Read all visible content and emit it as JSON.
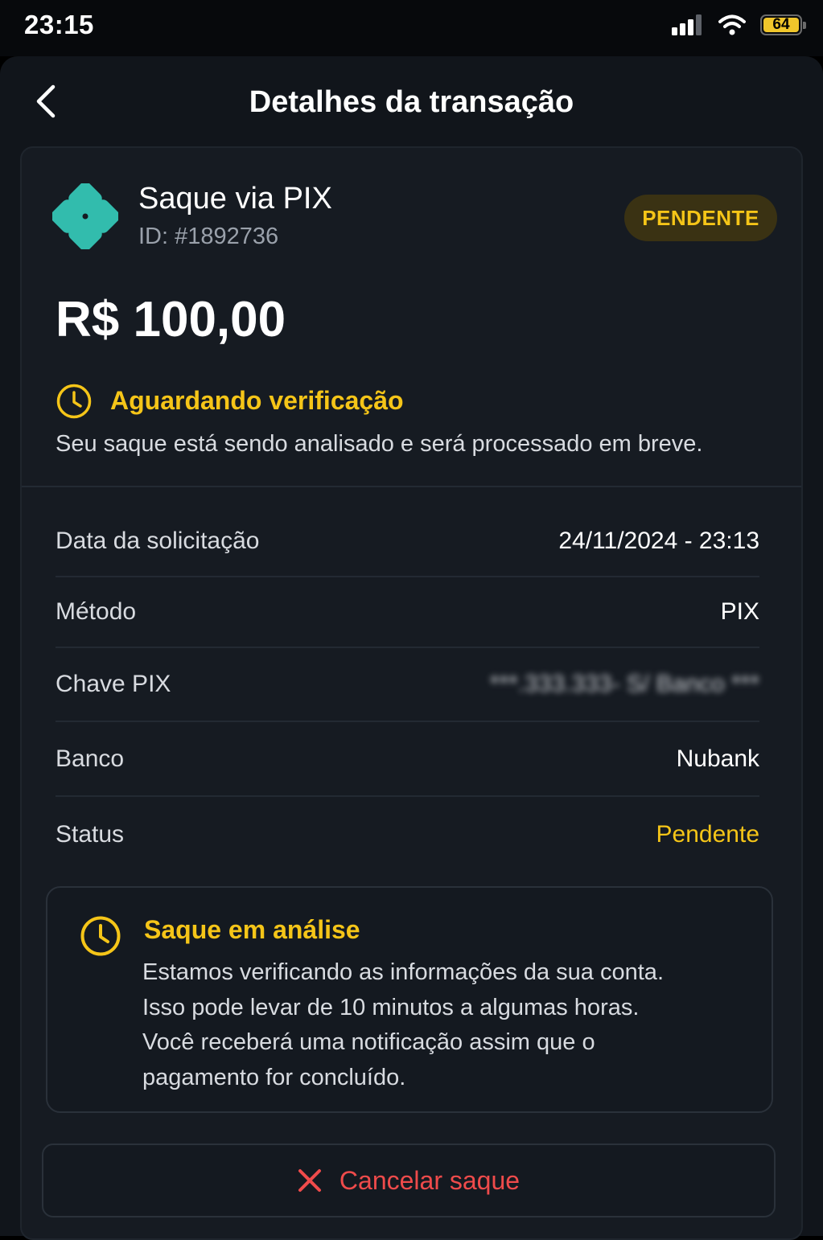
{
  "status_bar": {
    "time": "23:15",
    "battery": "64",
    "icons": [
      "signal-icon",
      "wifi-icon",
      "battery-icon"
    ]
  },
  "nav": {
    "title": "Detalhes da transação",
    "back_icon": "chevron-left-icon"
  },
  "transaction": {
    "title": "Saque via PIX",
    "id": "ID: #1892736",
    "badge": "PENDENTE",
    "amount": "R$ 100,00",
    "verification_title": "Aguardando verificação",
    "verification_desc": "Seu saque está sendo analisado e será processado em breve."
  },
  "details": [
    {
      "label": "Data da solicitação",
      "value": "24/11/2024 - 23:13"
    },
    {
      "label": "Método",
      "value": "PIX"
    },
    {
      "label": "Chave PIX",
      "value": "***.333.333- S/ Banco ***"
    },
    {
      "label": "Banco",
      "value": "Nubank"
    },
    {
      "label": "Status",
      "value": "Pendente"
    }
  ],
  "info_box": {
    "title": "Saque em análise",
    "lines": [
      "Estamos verificando as informações da sua conta.",
      "Isso pode levar de 10 minutos a algumas horas.",
      "Você receberá uma notificação assim que o",
      "pagamento for concluído."
    ]
  },
  "cancel_button": {
    "label": "Cancelar saque",
    "icon": "close-icon"
  },
  "colors": {
    "accent_yellow": "#f5c518",
    "danger_red": "#ef4b4b",
    "pix_teal": "#32bcad",
    "card_bg": "#161b22"
  }
}
